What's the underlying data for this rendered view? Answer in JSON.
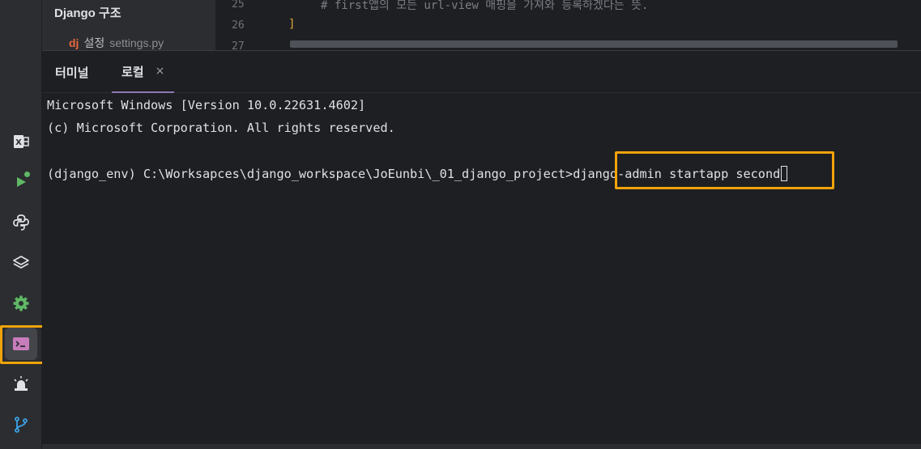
{
  "project": {
    "title": "Django 구조",
    "item_icon": "dj",
    "item_label": "설정",
    "item_file": "settings.py"
  },
  "editor": {
    "line_numbers": [
      "25",
      "26",
      "27"
    ],
    "comment_line": "# first앱의 모든 url-view 매핑을 가져와 등록하겠다는 뜻.",
    "bracket_line": "]"
  },
  "terminal": {
    "tabs": [
      {
        "label": "터미널"
      },
      {
        "label": "로컬",
        "close": "×"
      }
    ],
    "lines": [
      "Microsoft Windows [Version 10.0.22631.4602]",
      "(c) Microsoft Corporation. All rights reserved.",
      ""
    ],
    "prompt": "(django_env) C:\\Worksapces\\django_workspace\\JoEunbi\\_01_django_project>",
    "command": "django-admin startapp second"
  },
  "sidebar_icons": [
    "excel-icon",
    "run-icon",
    "python-icon",
    "layers-icon",
    "settings-gear-icon",
    "terminal-icon",
    "problems-alarm-icon",
    "git-branch-icon"
  ],
  "colors": {
    "highlight": "#f0a30a",
    "background": "#1e1f22",
    "panel": "#2b2d30",
    "accent": "#8e77b4"
  }
}
